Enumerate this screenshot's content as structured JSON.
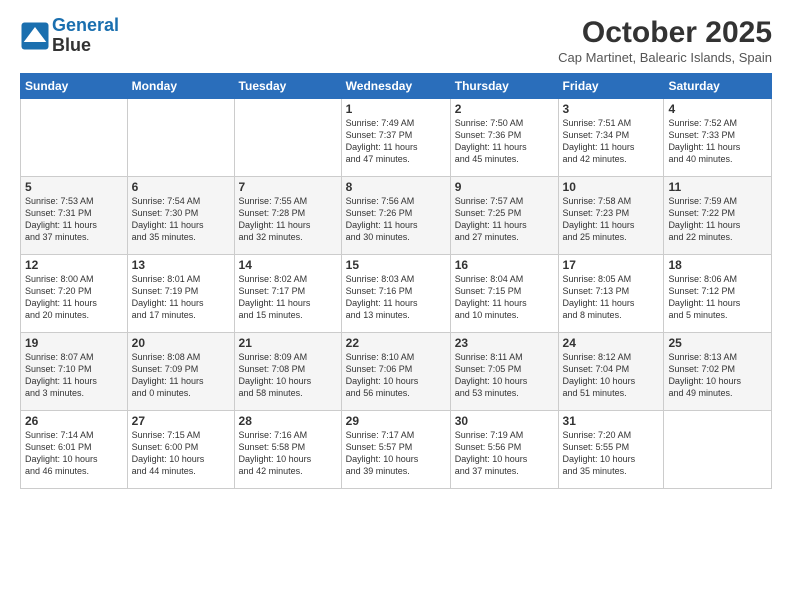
{
  "logo": {
    "line1": "General",
    "line2": "Blue"
  },
  "header": {
    "title": "October 2025",
    "subtitle": "Cap Martinet, Balearic Islands, Spain"
  },
  "weekdays": [
    "Sunday",
    "Monday",
    "Tuesday",
    "Wednesday",
    "Thursday",
    "Friday",
    "Saturday"
  ],
  "weeks": [
    [
      {
        "day": "",
        "info": ""
      },
      {
        "day": "",
        "info": ""
      },
      {
        "day": "",
        "info": ""
      },
      {
        "day": "1",
        "info": "Sunrise: 7:49 AM\nSunset: 7:37 PM\nDaylight: 11 hours\nand 47 minutes."
      },
      {
        "day": "2",
        "info": "Sunrise: 7:50 AM\nSunset: 7:36 PM\nDaylight: 11 hours\nand 45 minutes."
      },
      {
        "day": "3",
        "info": "Sunrise: 7:51 AM\nSunset: 7:34 PM\nDaylight: 11 hours\nand 42 minutes."
      },
      {
        "day": "4",
        "info": "Sunrise: 7:52 AM\nSunset: 7:33 PM\nDaylight: 11 hours\nand 40 minutes."
      }
    ],
    [
      {
        "day": "5",
        "info": "Sunrise: 7:53 AM\nSunset: 7:31 PM\nDaylight: 11 hours\nand 37 minutes."
      },
      {
        "day": "6",
        "info": "Sunrise: 7:54 AM\nSunset: 7:30 PM\nDaylight: 11 hours\nand 35 minutes."
      },
      {
        "day": "7",
        "info": "Sunrise: 7:55 AM\nSunset: 7:28 PM\nDaylight: 11 hours\nand 32 minutes."
      },
      {
        "day": "8",
        "info": "Sunrise: 7:56 AM\nSunset: 7:26 PM\nDaylight: 11 hours\nand 30 minutes."
      },
      {
        "day": "9",
        "info": "Sunrise: 7:57 AM\nSunset: 7:25 PM\nDaylight: 11 hours\nand 27 minutes."
      },
      {
        "day": "10",
        "info": "Sunrise: 7:58 AM\nSunset: 7:23 PM\nDaylight: 11 hours\nand 25 minutes."
      },
      {
        "day": "11",
        "info": "Sunrise: 7:59 AM\nSunset: 7:22 PM\nDaylight: 11 hours\nand 22 minutes."
      }
    ],
    [
      {
        "day": "12",
        "info": "Sunrise: 8:00 AM\nSunset: 7:20 PM\nDaylight: 11 hours\nand 20 minutes."
      },
      {
        "day": "13",
        "info": "Sunrise: 8:01 AM\nSunset: 7:19 PM\nDaylight: 11 hours\nand 17 minutes."
      },
      {
        "day": "14",
        "info": "Sunrise: 8:02 AM\nSunset: 7:17 PM\nDaylight: 11 hours\nand 15 minutes."
      },
      {
        "day": "15",
        "info": "Sunrise: 8:03 AM\nSunset: 7:16 PM\nDaylight: 11 hours\nand 13 minutes."
      },
      {
        "day": "16",
        "info": "Sunrise: 8:04 AM\nSunset: 7:15 PM\nDaylight: 11 hours\nand 10 minutes."
      },
      {
        "day": "17",
        "info": "Sunrise: 8:05 AM\nSunset: 7:13 PM\nDaylight: 11 hours\nand 8 minutes."
      },
      {
        "day": "18",
        "info": "Sunrise: 8:06 AM\nSunset: 7:12 PM\nDaylight: 11 hours\nand 5 minutes."
      }
    ],
    [
      {
        "day": "19",
        "info": "Sunrise: 8:07 AM\nSunset: 7:10 PM\nDaylight: 11 hours\nand 3 minutes."
      },
      {
        "day": "20",
        "info": "Sunrise: 8:08 AM\nSunset: 7:09 PM\nDaylight: 11 hours\nand 0 minutes."
      },
      {
        "day": "21",
        "info": "Sunrise: 8:09 AM\nSunset: 7:08 PM\nDaylight: 10 hours\nand 58 minutes."
      },
      {
        "day": "22",
        "info": "Sunrise: 8:10 AM\nSunset: 7:06 PM\nDaylight: 10 hours\nand 56 minutes."
      },
      {
        "day": "23",
        "info": "Sunrise: 8:11 AM\nSunset: 7:05 PM\nDaylight: 10 hours\nand 53 minutes."
      },
      {
        "day": "24",
        "info": "Sunrise: 8:12 AM\nSunset: 7:04 PM\nDaylight: 10 hours\nand 51 minutes."
      },
      {
        "day": "25",
        "info": "Sunrise: 8:13 AM\nSunset: 7:02 PM\nDaylight: 10 hours\nand 49 minutes."
      }
    ],
    [
      {
        "day": "26",
        "info": "Sunrise: 7:14 AM\nSunset: 6:01 PM\nDaylight: 10 hours\nand 46 minutes."
      },
      {
        "day": "27",
        "info": "Sunrise: 7:15 AM\nSunset: 6:00 PM\nDaylight: 10 hours\nand 44 minutes."
      },
      {
        "day": "28",
        "info": "Sunrise: 7:16 AM\nSunset: 5:58 PM\nDaylight: 10 hours\nand 42 minutes."
      },
      {
        "day": "29",
        "info": "Sunrise: 7:17 AM\nSunset: 5:57 PM\nDaylight: 10 hours\nand 39 minutes."
      },
      {
        "day": "30",
        "info": "Sunrise: 7:19 AM\nSunset: 5:56 PM\nDaylight: 10 hours\nand 37 minutes."
      },
      {
        "day": "31",
        "info": "Sunrise: 7:20 AM\nSunset: 5:55 PM\nDaylight: 10 hours\nand 35 minutes."
      },
      {
        "day": "",
        "info": ""
      }
    ]
  ]
}
